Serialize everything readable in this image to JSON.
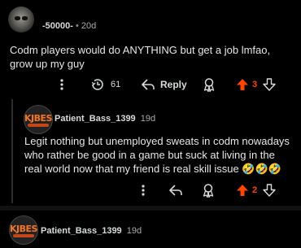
{
  "comments": [
    {
      "username": "-50000-",
      "timestamp": "20d",
      "text_lines": [
        "Codm players would do ANYTHING but get a job lmfao,",
        "grow up my guy"
      ],
      "reply_count": "61",
      "reply_label": "Reply",
      "score": "3"
    },
    {
      "username": "Patient_Bass_1399",
      "timestamp": "19d",
      "text_lines": [
        "Legit nothing but unemployed sweats in codm nowadays",
        "who rather be good in a game but suck at living in the",
        "real world now that my friend is real skill issue 🤣🤣🤣"
      ],
      "score": "2"
    },
    {
      "username": "Patient_Bass_1399",
      "timestamp": "19d"
    }
  ],
  "avatar_logo_text": "KJBES",
  "colors": {
    "upvote_active": "#ff4500",
    "background": "#000000",
    "muted": "#a8aaab"
  },
  "icons": {
    "more": "more-vertical-icon",
    "replies": "clock-reply-count-icon",
    "reply": "reply-arrow-icon",
    "award": "award-icon",
    "upvote": "upvote-arrow-icon",
    "downvote": "downvote-arrow-icon"
  }
}
